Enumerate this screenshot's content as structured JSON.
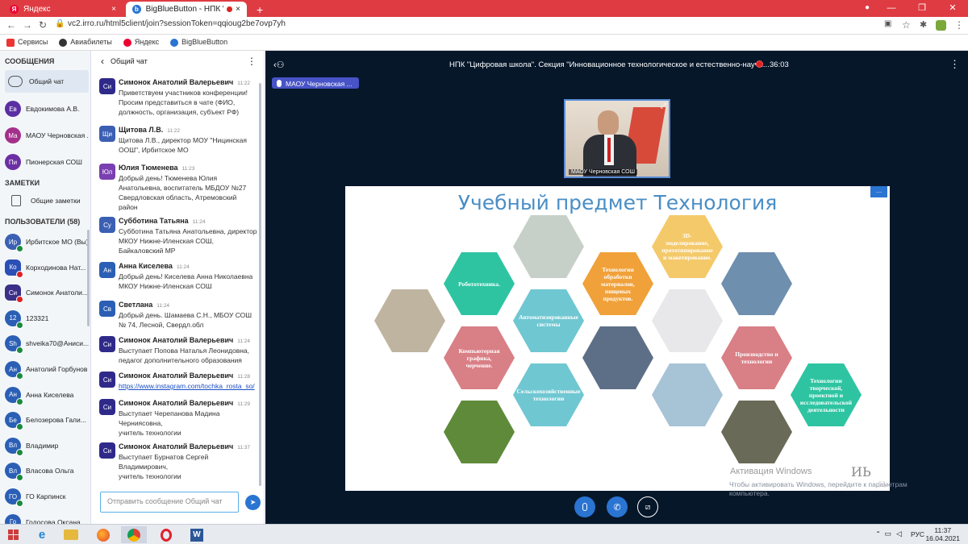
{
  "browser": {
    "tabs": [
      {
        "label": "Яндекс",
        "close": "×"
      },
      {
        "label": "BigBlueButton - НПК \"Циф...",
        "close": "×"
      }
    ],
    "new_tab": "+",
    "url": "vc2.irro.ru/html5client/join?sessionToken=qqioug2be7ovp7yh",
    "bookmarks": [
      "Сервисы",
      "Авиабилеты",
      "Яндекс",
      "BigBlueButton"
    ]
  },
  "sidebar": {
    "messages_header": "СООБЩЕНИЯ",
    "public_chat": "Общий чат",
    "chats": [
      {
        "initials": "Ев",
        "name": "Евдокимова А.В.",
        "color": "#5b2fa3"
      },
      {
        "initials": "Ма",
        "name": "МАОУ Черновская ...",
        "color": "#a3308a"
      },
      {
        "initials": "Пи",
        "name": "Пионерская СОШ",
        "color": "#6b2fa3"
      }
    ],
    "notes_header": "ЗАМЕТКИ",
    "shared_notes": "Общие заметки",
    "users_header": "ПОЛЬЗОВАТЕЛИ (58)",
    "users": [
      {
        "initials": "Ир",
        "name": "Ирбитское МО (Вы)",
        "color": "#3b5fb3",
        "mic": "on",
        "round": true
      },
      {
        "initials": "Ко",
        "name": "Корходинова Нат...",
        "color": "#2b4fb5",
        "mic": "off"
      },
      {
        "initials": "Си",
        "name": "Симонок Анатоли...",
        "color": "#3b2f88",
        "mic": "off"
      },
      {
        "initials": "12",
        "name": "123321",
        "color": "#2b5fb5",
        "mic": "on",
        "round": true
      },
      {
        "initials": "Sh",
        "name": "shveika70@Аниси...",
        "color": "#2b5fb5",
        "mic": "on",
        "round": true
      },
      {
        "initials": "Ан",
        "name": "Анатолий Горбунов",
        "color": "#2b5fb5",
        "mic": "on",
        "round": true
      },
      {
        "initials": "Ан",
        "name": "Анна Киселева",
        "color": "#2b5fb5",
        "mic": "on",
        "round": true
      },
      {
        "initials": "Бе",
        "name": "Белозерова Гали...",
        "color": "#2b5fb5",
        "mic": "on",
        "round": true
      },
      {
        "initials": "Вл",
        "name": "Владимир",
        "color": "#2b5fb5",
        "mic": "on",
        "round": true
      },
      {
        "initials": "Вл",
        "name": "Власова Ольга",
        "color": "#2b5fb5",
        "mic": "on",
        "round": true
      },
      {
        "initials": "ГО",
        "name": "ГО Карпинск",
        "color": "#2b5fb5",
        "mic": "on",
        "round": true
      },
      {
        "initials": "Го",
        "name": "Голосова Оксана",
        "color": "#2b5fb5",
        "mic": "on",
        "round": true
      }
    ]
  },
  "chat": {
    "back": "‹",
    "title": "Общий чат",
    "menu": "⋮",
    "messages": [
      {
        "initials": "Си",
        "color": "#2f2a8a",
        "author": "Симонок Анатолий Валерьевич",
        "time": "11:22",
        "lines": [
          "Приветствуем участников конференции!",
          "Просим представиться в чате (ФИО,",
          "должность, организация, субъект РФ)"
        ]
      },
      {
        "initials": "Щи",
        "color": "#3b5fb3",
        "author": "Щитова Л.В.",
        "time": "11:22",
        "lines": [
          "Щитова Л.В., директор МОУ \"Ницинская",
          "ООШ\", Ирбитское МО"
        ]
      },
      {
        "initials": "Юл",
        "color": "#7a3fb0",
        "author": "Юлия Тюменева",
        "time": "11:23",
        "lines": [
          "Добрый день! Тюменева Юлия",
          "Анатольевна, воспитатель МБДОУ №27",
          "Свердловская область, Атремовский",
          "район"
        ]
      },
      {
        "initials": "Су",
        "color": "#3b5fb3",
        "author": "Субботина Татьяна",
        "time": "11:24",
        "lines": [
          "Субботина Татьяна Анатольевна, директор",
          "МКОУ Нижне-Иленская СОШ,",
          "Байкаловский МР"
        ]
      },
      {
        "initials": "Ан",
        "color": "#2b5fb5",
        "author": "Анна Киселева",
        "time": "11:24",
        "lines": [
          "Добрый день! Киселева Анна Николаевна",
          "МКОУ Нижне-Иленская СОШ"
        ]
      },
      {
        "initials": "Св",
        "color": "#2b5fb5",
        "author": "Светлана",
        "time": "11:24",
        "lines": [
          "Добрый день. Шамаева С.Н., МБОУ СОШ",
          "№ 74, Лесной, Свердл.обл"
        ]
      },
      {
        "initials": "Си",
        "color": "#2f2a8a",
        "author": "Симонок Анатолий Валерьевич",
        "time": "11:24",
        "lines": [
          "Выступает Попова Наталья Леонидовна,",
          "педагог дополнительного образования"
        ]
      },
      {
        "initials": "Си",
        "color": "#2f2a8a",
        "author": "Симонок Анатолий Валерьевич",
        "time": "11:28",
        "lines": [
          "https://www.instagram.com/tochka_rosta_so/"
        ],
        "link": true
      },
      {
        "initials": "Си",
        "color": "#2f2a8a",
        "author": "Симонок Анатолий Валерьевич",
        "time": "11:29",
        "lines": [
          "Выступает Черепанова Мадина",
          "Черниясовна,",
          "учитель технологии"
        ]
      },
      {
        "initials": "Си",
        "color": "#2f2a8a",
        "author": "Симонок Анатолий Валерьевич",
        "time": "11:37",
        "lines": [
          "Выступает Бурнатов Сергей",
          "Владимирович,",
          "учитель технологии"
        ]
      }
    ],
    "input_placeholder": "Отправить сообщение Общий чат"
  },
  "meeting": {
    "title": "НПК \"Цифровая школа\". Секция \"Инновационное технологическое и естественно-научн...",
    "timer": "36:03",
    "talking": "МАОУ Черновская ...",
    "camera_label": "МАОУ Черновская СОШ"
  },
  "slide": {
    "title": "Учебный предмет Технология",
    "hexes": [
      {
        "label": "Робототехника.",
        "color": "#2ec4a2"
      },
      {
        "label": "Технологии обработки материалов, пищевых продуктов.",
        "color": "#f0a13a"
      },
      {
        "label": "3D-моделирование, прототипирование и макетирование.",
        "color": "#f4c96a"
      },
      {
        "label": "Автоматизированные системы",
        "color": "#6fc7d2"
      },
      {
        "label": "Компьютерная графика, черчение.",
        "color": "#d97f86"
      },
      {
        "label": "Производство и технологии",
        "color": "#d97f86"
      },
      {
        "label": "Сельскохозяйственные технологии",
        "color": "#6fc7d2"
      },
      {
        "label": "Технологии творческой, проектной и исследовательской деятельности",
        "color": "#2ec4a2"
      }
    ],
    "watermark_title": "Активация Windows",
    "watermark_text": "Чтобы активировать Windows, перейдите к параметрам компьютера."
  },
  "taskbar": {
    "lang": "РУС",
    "time": "11:37",
    "date": "16.04.2021"
  }
}
